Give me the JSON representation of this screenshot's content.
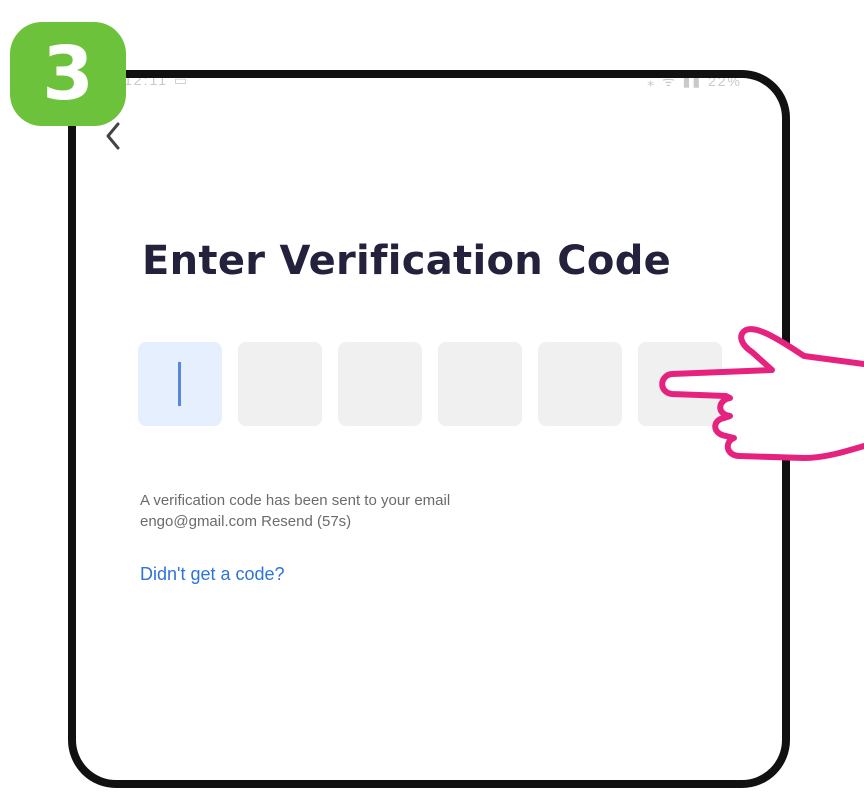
{
  "step": {
    "number": "3",
    "color": "#6cc23a"
  },
  "status_bar": {
    "left": "12:11 ▭",
    "right": "⁎ ᯤ ▮▮ 22%"
  },
  "header": {
    "back_icon": "chevron-left-icon"
  },
  "page": {
    "title": "Enter Verification Code"
  },
  "code_input": {
    "length": 6,
    "digits": [
      "",
      "",
      "",
      "",
      "",
      ""
    ],
    "active_index": 0,
    "active_color": "#e6effd",
    "empty_color": "#f0f0f0"
  },
  "info": {
    "line1": "A verification code has been sent to your email",
    "line2": "engo@gmail.com Resend (57s)"
  },
  "help_link": {
    "label": "Didn't get a code?",
    "color": "#2f72d8"
  },
  "annotation": {
    "icon": "pointing-hand-icon",
    "color": "#e5237f"
  }
}
